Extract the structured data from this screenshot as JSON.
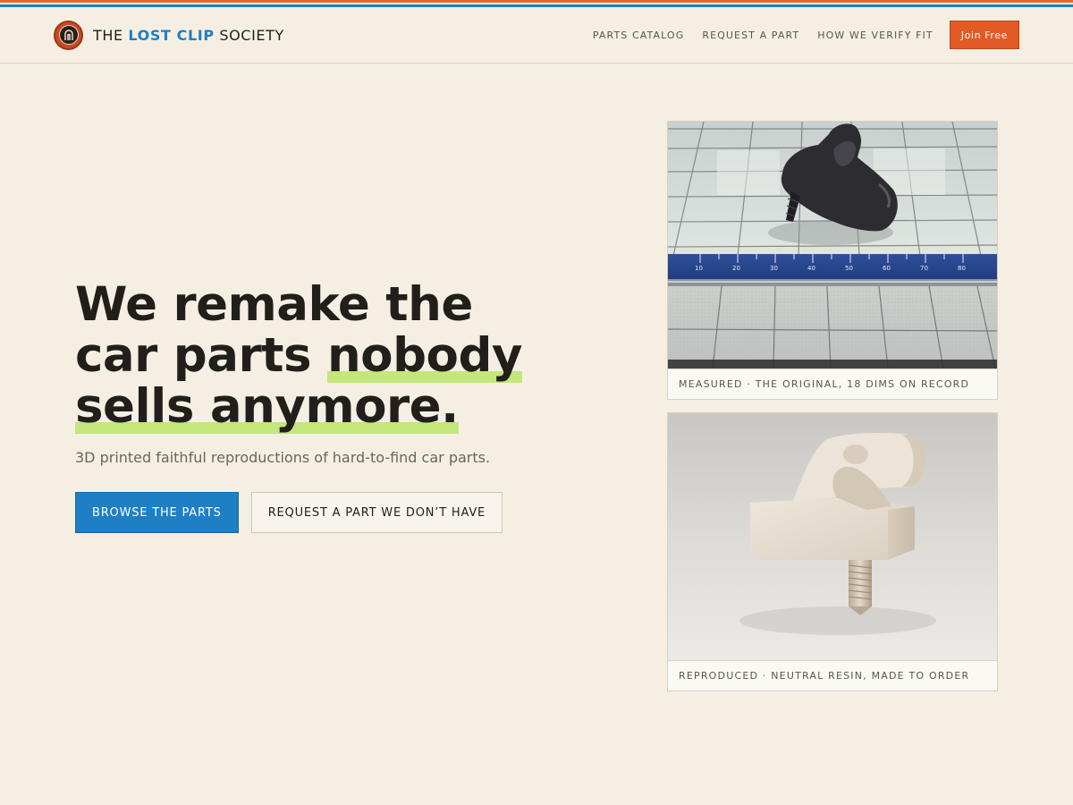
{
  "colors": {
    "background": "#f5efe3",
    "accent_blue": "#1f7fc4",
    "accent_orange": "#e25a24",
    "highlight_green": "#c4e67a",
    "text_dark": "#221f1b"
  },
  "brand": {
    "prefix": "THE ",
    "accent": "LOST CLIP",
    "suffix": " SOCIETY",
    "logo_icon": "clip-emblem-icon"
  },
  "nav": {
    "items": [
      {
        "label": "PARTS CATALOG"
      },
      {
        "label": "REQUEST A PART"
      },
      {
        "label": "HOW WE VERIFY FIT"
      }
    ],
    "join_label": "Join Free"
  },
  "hero": {
    "headline_line1": "We remake the",
    "headline_line2_pre": "car parts ",
    "headline_line2_highlight": "nobody",
    "headline_line3_highlight": "sells anymore.",
    "subtitle": "3D printed faithful reproductions of hard-to-find car parts.",
    "primary_cta": "BROWSE THE PARTS",
    "secondary_cta": "REQUEST A PART WE DON’T HAVE"
  },
  "photos": {
    "measured": {
      "caption": "MEASURED · THE ORIGINAL, 18 DIMS ON RECORD",
      "ruler_numbers": [
        "10",
        "20",
        "30",
        "40",
        "50",
        "60",
        "70",
        "80"
      ]
    },
    "reproduced": {
      "caption": "REPRODUCED · NEUTRAL RESIN, MADE TO ORDER"
    }
  }
}
